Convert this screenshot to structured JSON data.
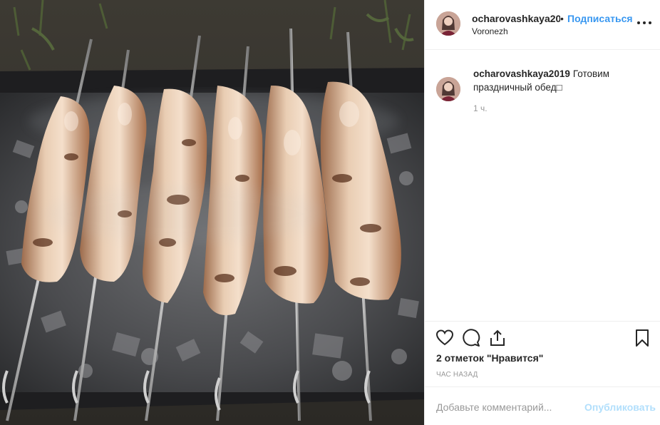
{
  "post": {
    "username": "ocharovashkaya2019",
    "username_truncated": "ocharovashkaya201",
    "separator": "•",
    "follow_label": "Подписаться",
    "location": "Voronezh",
    "caption_username": "ocharovashkaya2019",
    "caption_text": "Готовим праздничный обед□",
    "caption_time": "1 ч.",
    "likes_text": "2 отметок \"Нравится\"",
    "posted_ago": "час назад",
    "comment_placeholder": "Добавьте комментарий...",
    "publish_label": "Опубликовать"
  },
  "icons": {
    "like": "heart-outline-icon",
    "comment": "speech-bubble-icon",
    "share": "share-arrow-icon",
    "save": "bookmark-icon",
    "more": "three-dots-icon"
  },
  "colors": {
    "link_blue": "#3897f0",
    "publish_disabled": "#b2dffc",
    "muted_text": "#999999",
    "border": "#efefef"
  }
}
